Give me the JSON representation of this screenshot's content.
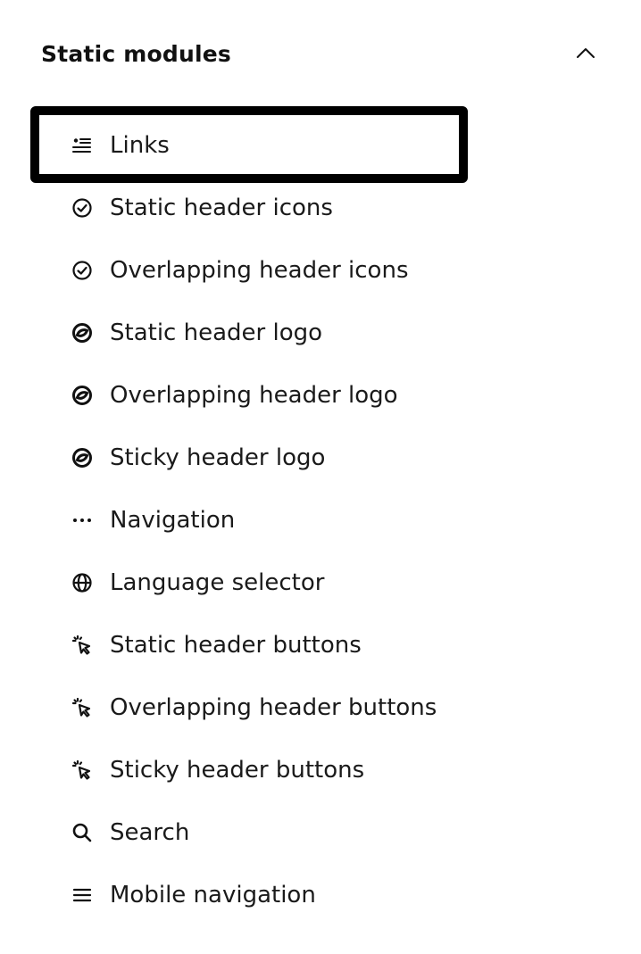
{
  "section": {
    "title": "Static modules",
    "expanded": true,
    "toggle_icon": "chevron-up-icon"
  },
  "modules": [
    {
      "label": "Links",
      "icon": "links-list-icon",
      "selected": true
    },
    {
      "label": "Static header icons",
      "icon": "check-circle-icon",
      "selected": false
    },
    {
      "label": "Overlapping header icons",
      "icon": "check-circle-icon",
      "selected": false
    },
    {
      "label": "Static header logo",
      "icon": "logo-icon",
      "selected": false
    },
    {
      "label": "Overlapping header logo",
      "icon": "logo-icon",
      "selected": false
    },
    {
      "label": "Sticky header logo",
      "icon": "logo-icon",
      "selected": false
    },
    {
      "label": "Navigation",
      "icon": "ellipsis-icon",
      "selected": false
    },
    {
      "label": "Language selector",
      "icon": "globe-icon",
      "selected": false
    },
    {
      "label": "Static header buttons",
      "icon": "click-cursor-icon",
      "selected": false
    },
    {
      "label": "Overlapping header buttons",
      "icon": "click-cursor-icon",
      "selected": false
    },
    {
      "label": "Sticky header buttons",
      "icon": "click-cursor-icon",
      "selected": false
    },
    {
      "label": "Search",
      "icon": "search-icon",
      "selected": false
    },
    {
      "label": "Mobile navigation",
      "icon": "hamburger-menu-icon",
      "selected": false
    }
  ]
}
